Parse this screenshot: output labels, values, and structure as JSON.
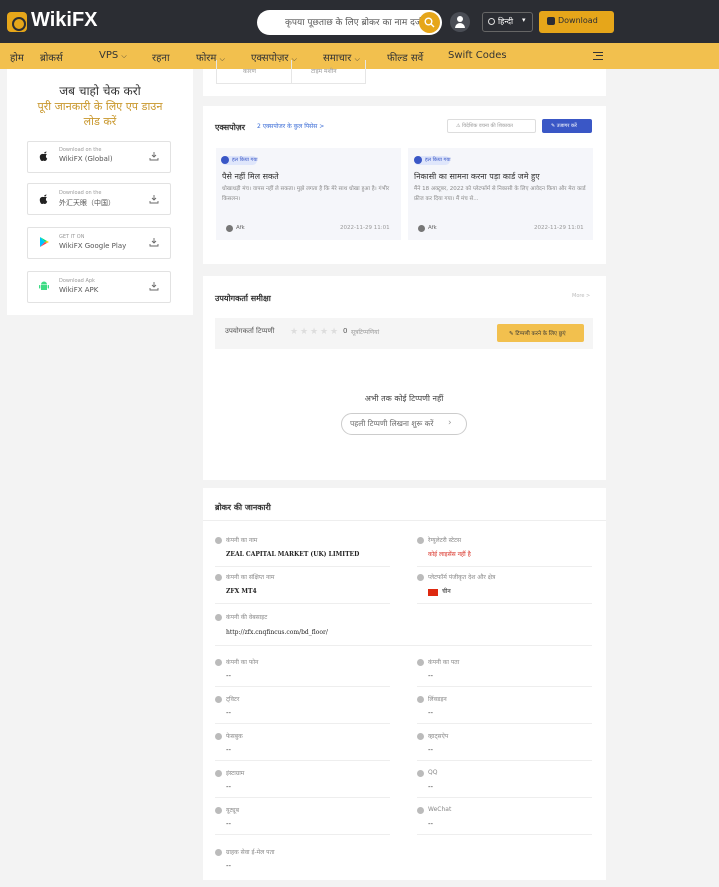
{
  "header": {
    "brand": "WikiFX",
    "search_placeholder": "कृपया पूछताछ के लिए ब्रोकर का नाम दर्ज करें",
    "language": "हिन्दी",
    "download": "Download"
  },
  "nav": {
    "items": [
      "होम",
      "ब्रोकर्स",
      "VPS",
      "रहना",
      "फोरम",
      "एक्सपोज़र",
      "समाचार",
      "फील्ड सर्वे",
      "Swift Codes"
    ]
  },
  "sidebar": {
    "title": "जब चाहो चेक करो",
    "subtitle": "पूरी जानकारी के लिए एप डाउन लोड करें",
    "apps": [
      {
        "small": "Download on the",
        "name": "WikiFX (Global)",
        "icon": "apple-icon"
      },
      {
        "small": "Download on the",
        "name": "外汇天眼（中国）",
        "icon": "apple-icon"
      },
      {
        "small": "GET IT ON",
        "name": "WikiFX Google Play",
        "icon": "google-play-icon"
      },
      {
        "small": "Download Apk",
        "name": "WikiFX APK",
        "icon": "android-icon"
      }
    ]
  },
  "top_tabs": {
    "left": "कारण",
    "right": "टाइम मशीन"
  },
  "exposure": {
    "title": "एक्सपोज़र",
    "count": "2 एक्सपोजर के कुल पिसेस >",
    "report_button": "विदेशिक वचना की शिकायत",
    "expose_button": "उजागर करें",
    "cases": [
      {
        "tag": "हल किया गया",
        "title": "पैसे नहीं मिल सकते",
        "body": "धोखाधड़ी मंच। वापस नहीं ले सकता। मुझे लगता है कि मेरे साथ धोखा हुआ है। गंभीर किसलन।",
        "user": "Afk",
        "date": "2022-11-29 11:01"
      },
      {
        "tag": "हल किया गया",
        "title": "निकासी का सामना करना पड़ा कार्ड जमे हुए",
        "body": "मैंने 18 अक्टूबर, 2022 को प्लेटफॉर्म से निकासी के लिए आवेदन किया और मेरा कार्ड फ्रीज कर दिया गया। मैं मंच से...",
        "user": "Afk",
        "date": "2022-11-29 11:01"
      }
    ]
  },
  "reviews": {
    "title": "उपयोगकर्ता समीक्षा",
    "more": "More >",
    "comment_label": "उपयोगकर्ता टिप्पणी",
    "rating_count": "0",
    "count_label": "सूत्रटिप्पणियां",
    "write_button": "टिप्पणी करने के लिए छुएं",
    "empty": "अभी तक कोई टिप्पणी नहीं",
    "first_button": "पहली टिप्पणी लिखना शुरू करें"
  },
  "broker_info": {
    "title": "ब्रोकर की जानकारी",
    "company_name_label": "कंपनी का नाम",
    "company_name": "ZEAL CAPITAL MARKET (UK) LIMITED",
    "regulatory_label": "रेग्युलेटरी स्टेटस",
    "regulatory": "कोई लाइसेंस नहीं है",
    "short_name_label": "कंपनी का संक्षिप्त नाम",
    "short_name": "ZFX MT4",
    "country_label": "प्लेटफॉर्म पंजीकृत देश और क्षेत्र",
    "country": "चीन",
    "website_label": "कंपनी की वेबसाइट",
    "website": "http://zfx.cnqfincus.com/bd_floor/",
    "phone_label": "कंपनी का फोन",
    "phone": "--",
    "address_label": "कंपनी का पता",
    "address": "--",
    "twitter_label": "ट्विटर",
    "twitter": "--",
    "linkedin_label": "लिंक्डइन",
    "linkedin": "--",
    "facebook_label": "फेसबुक",
    "facebook": "--",
    "whatsapp_label": "व्हाट्सऐप",
    "whatsapp": "--",
    "instagram_label": "इंस्टाग्राम",
    "instagram": "--",
    "qq_label": "QQ",
    "qq": "--",
    "youtube_label": "यूट्यूब",
    "youtube": "--",
    "wechat_label": "WeChat",
    "wechat": "--",
    "email_label": "ग्राहक सेवा ई-मेल पता",
    "email": "--"
  },
  "colors": {
    "header_bg": "#2b2d33",
    "accent": "#f2c04e",
    "brand_gold": "#e6a61a",
    "link_blue": "#3a57c6",
    "danger": "#d93025"
  }
}
